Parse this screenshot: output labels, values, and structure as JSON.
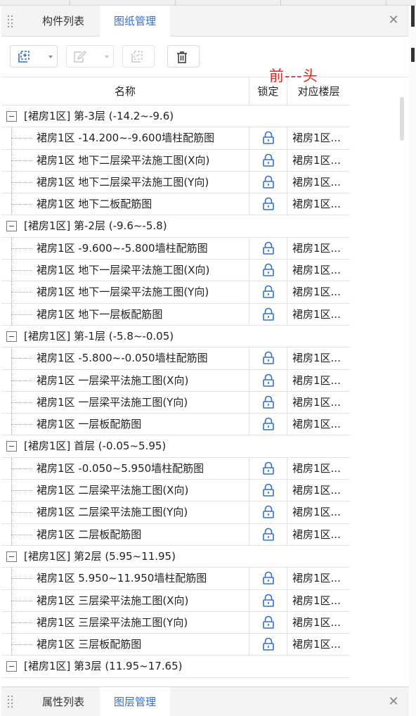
{
  "tabs_top": [
    {
      "label": "构件列表",
      "active": false
    },
    {
      "label": "图纸管理",
      "active": true
    }
  ],
  "tabs_bottom": [
    {
      "label": "属性列表",
      "active": false
    },
    {
      "label": "图层管理",
      "active": true
    }
  ],
  "toolbar": {
    "buttons": [
      {
        "icon": "add-drawing-icon",
        "has_dropdown": true,
        "enabled": true
      },
      {
        "icon": "edit-drawing-icon",
        "has_dropdown": true,
        "enabled": false
      },
      {
        "icon": "split-drawing-icon",
        "has_dropdown": false,
        "enabled": false
      },
      {
        "icon": "delete-icon",
        "has_dropdown": false,
        "enabled": true
      }
    ]
  },
  "annotation": "前---头",
  "columns": {
    "name": "名称",
    "lock": "锁定",
    "floor": "对应楼层"
  },
  "groups": [
    {
      "title": "[裙房1区] 第-3层 (-14.2~-9.6)",
      "items": [
        {
          "name": "裙房1区 -14.200~-9.600墙柱配筋图",
          "floor": "裙房1区..."
        },
        {
          "name": "裙房1区 地下二层梁平法施工图(X向)",
          "floor": "裙房1区..."
        },
        {
          "name": "裙房1区 地下二层梁平法施工图(Y向)",
          "floor": "裙房1区..."
        },
        {
          "name": "裙房1区 地下二板配筋图",
          "floor": "裙房1区..."
        }
      ]
    },
    {
      "title": "[裙房1区] 第-2层 (-9.6~-5.8)",
      "items": [
        {
          "name": "裙房1区 -9.600~-5.800墙柱配筋图",
          "floor": "裙房1区..."
        },
        {
          "name": "裙房1区 地下一层梁平法施工图(X向)",
          "floor": "裙房1区..."
        },
        {
          "name": "裙房1区 地下一层梁平法施工图(Y向)",
          "floor": "裙房1区..."
        },
        {
          "name": "裙房1区 地下一层板配筋图",
          "floor": "裙房1区..."
        }
      ]
    },
    {
      "title": "[裙房1区] 第-1层 (-5.8~-0.05)",
      "items": [
        {
          "name": "裙房1区 -5.800~-0.050墙柱配筋图",
          "floor": "裙房1区..."
        },
        {
          "name": "裙房1区 一层梁平法施工图(X向)",
          "floor": "裙房1区..."
        },
        {
          "name": "裙房1区 一层梁平法施工图(Y向)",
          "floor": "裙房1区..."
        },
        {
          "name": "裙房1区 一层板配筋图",
          "floor": "裙房1区..."
        }
      ]
    },
    {
      "title": "[裙房1区] 首层 (-0.05~5.95)",
      "items": [
        {
          "name": "裙房1区 -0.050~5.950墙柱配筋图",
          "floor": "裙房1区..."
        },
        {
          "name": "裙房1区 二层梁平法施工图(X向)",
          "floor": "裙房1区..."
        },
        {
          "name": "裙房1区 二层梁平法施工图(Y向)",
          "floor": "裙房1区..."
        },
        {
          "name": "裙房1区 二层板配筋图",
          "floor": "裙房1区..."
        }
      ]
    },
    {
      "title": "[裙房1区] 第2层 (5.95~11.95)",
      "items": [
        {
          "name": "裙房1区 5.950~11.950墙柱配筋图",
          "floor": "裙房1区..."
        },
        {
          "name": "裙房1区 三层梁平法施工图(X向)",
          "floor": "裙房1区..."
        },
        {
          "name": "裙房1区 三层梁平法施工图(Y向)",
          "floor": "裙房1区..."
        },
        {
          "name": "裙房1区 三层板配筋图",
          "floor": "裙房1区..."
        }
      ]
    },
    {
      "title": "[裙房1区] 第3层 (11.95~17.65)",
      "items": []
    }
  ],
  "colors": {
    "accent": "#2e6fd6",
    "annotation": "#e8271c",
    "lock_icon": "#2e6fd6"
  }
}
